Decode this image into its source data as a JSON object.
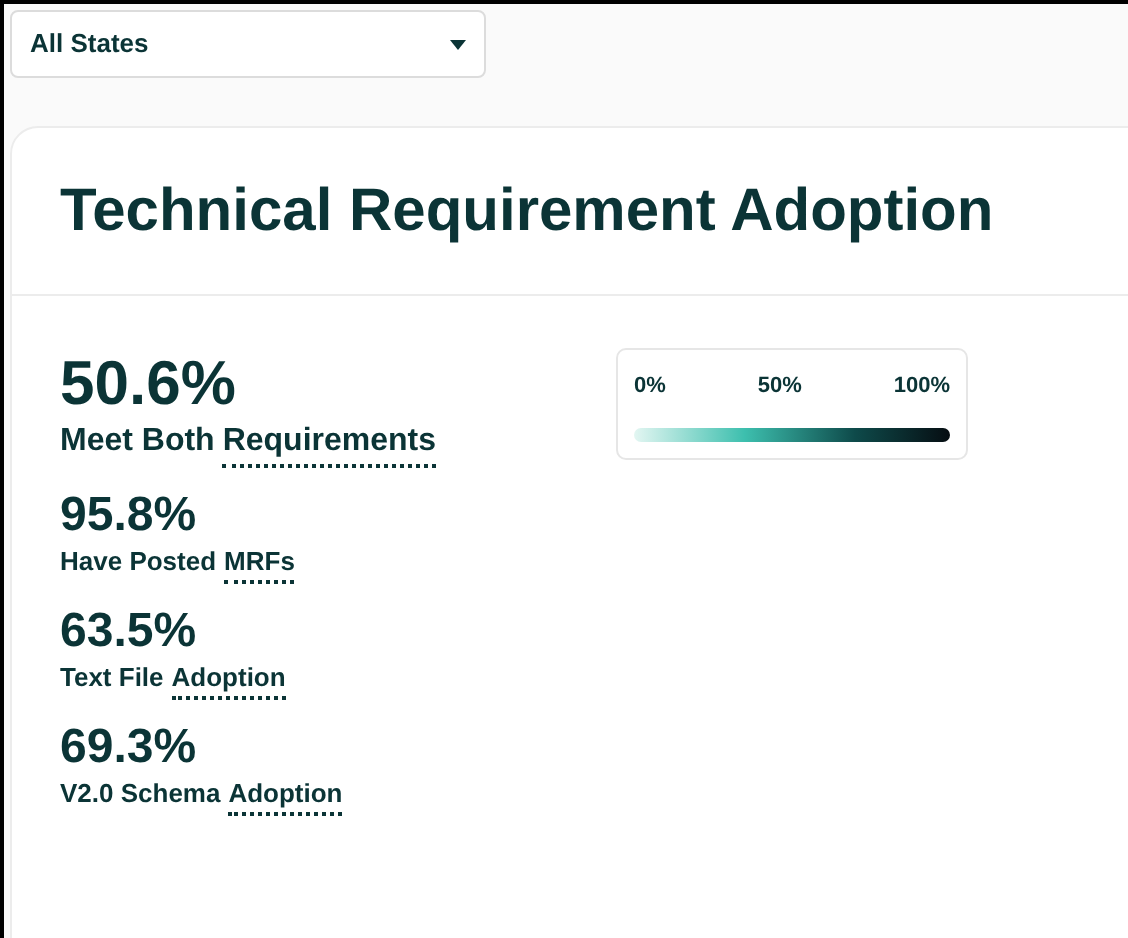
{
  "filter": {
    "value": "All States"
  },
  "card": {
    "title": "Technical Requirement Adoption",
    "stats": [
      {
        "value": "50.6%",
        "label": "Meet Both",
        "term": "Requirements",
        "kind": "primary"
      },
      {
        "value": "95.8%",
        "label": "Have Posted",
        "term": "MRFs",
        "kind": "secondary"
      },
      {
        "value": "63.5%",
        "label": "Text File",
        "term": "Adoption",
        "kind": "secondary"
      },
      {
        "value": "69.3%",
        "label": "V2.0 Schema",
        "term": "Adoption",
        "kind": "secondary"
      }
    ],
    "legend": {
      "ticks": [
        "0%",
        "50%",
        "100%"
      ]
    }
  }
}
